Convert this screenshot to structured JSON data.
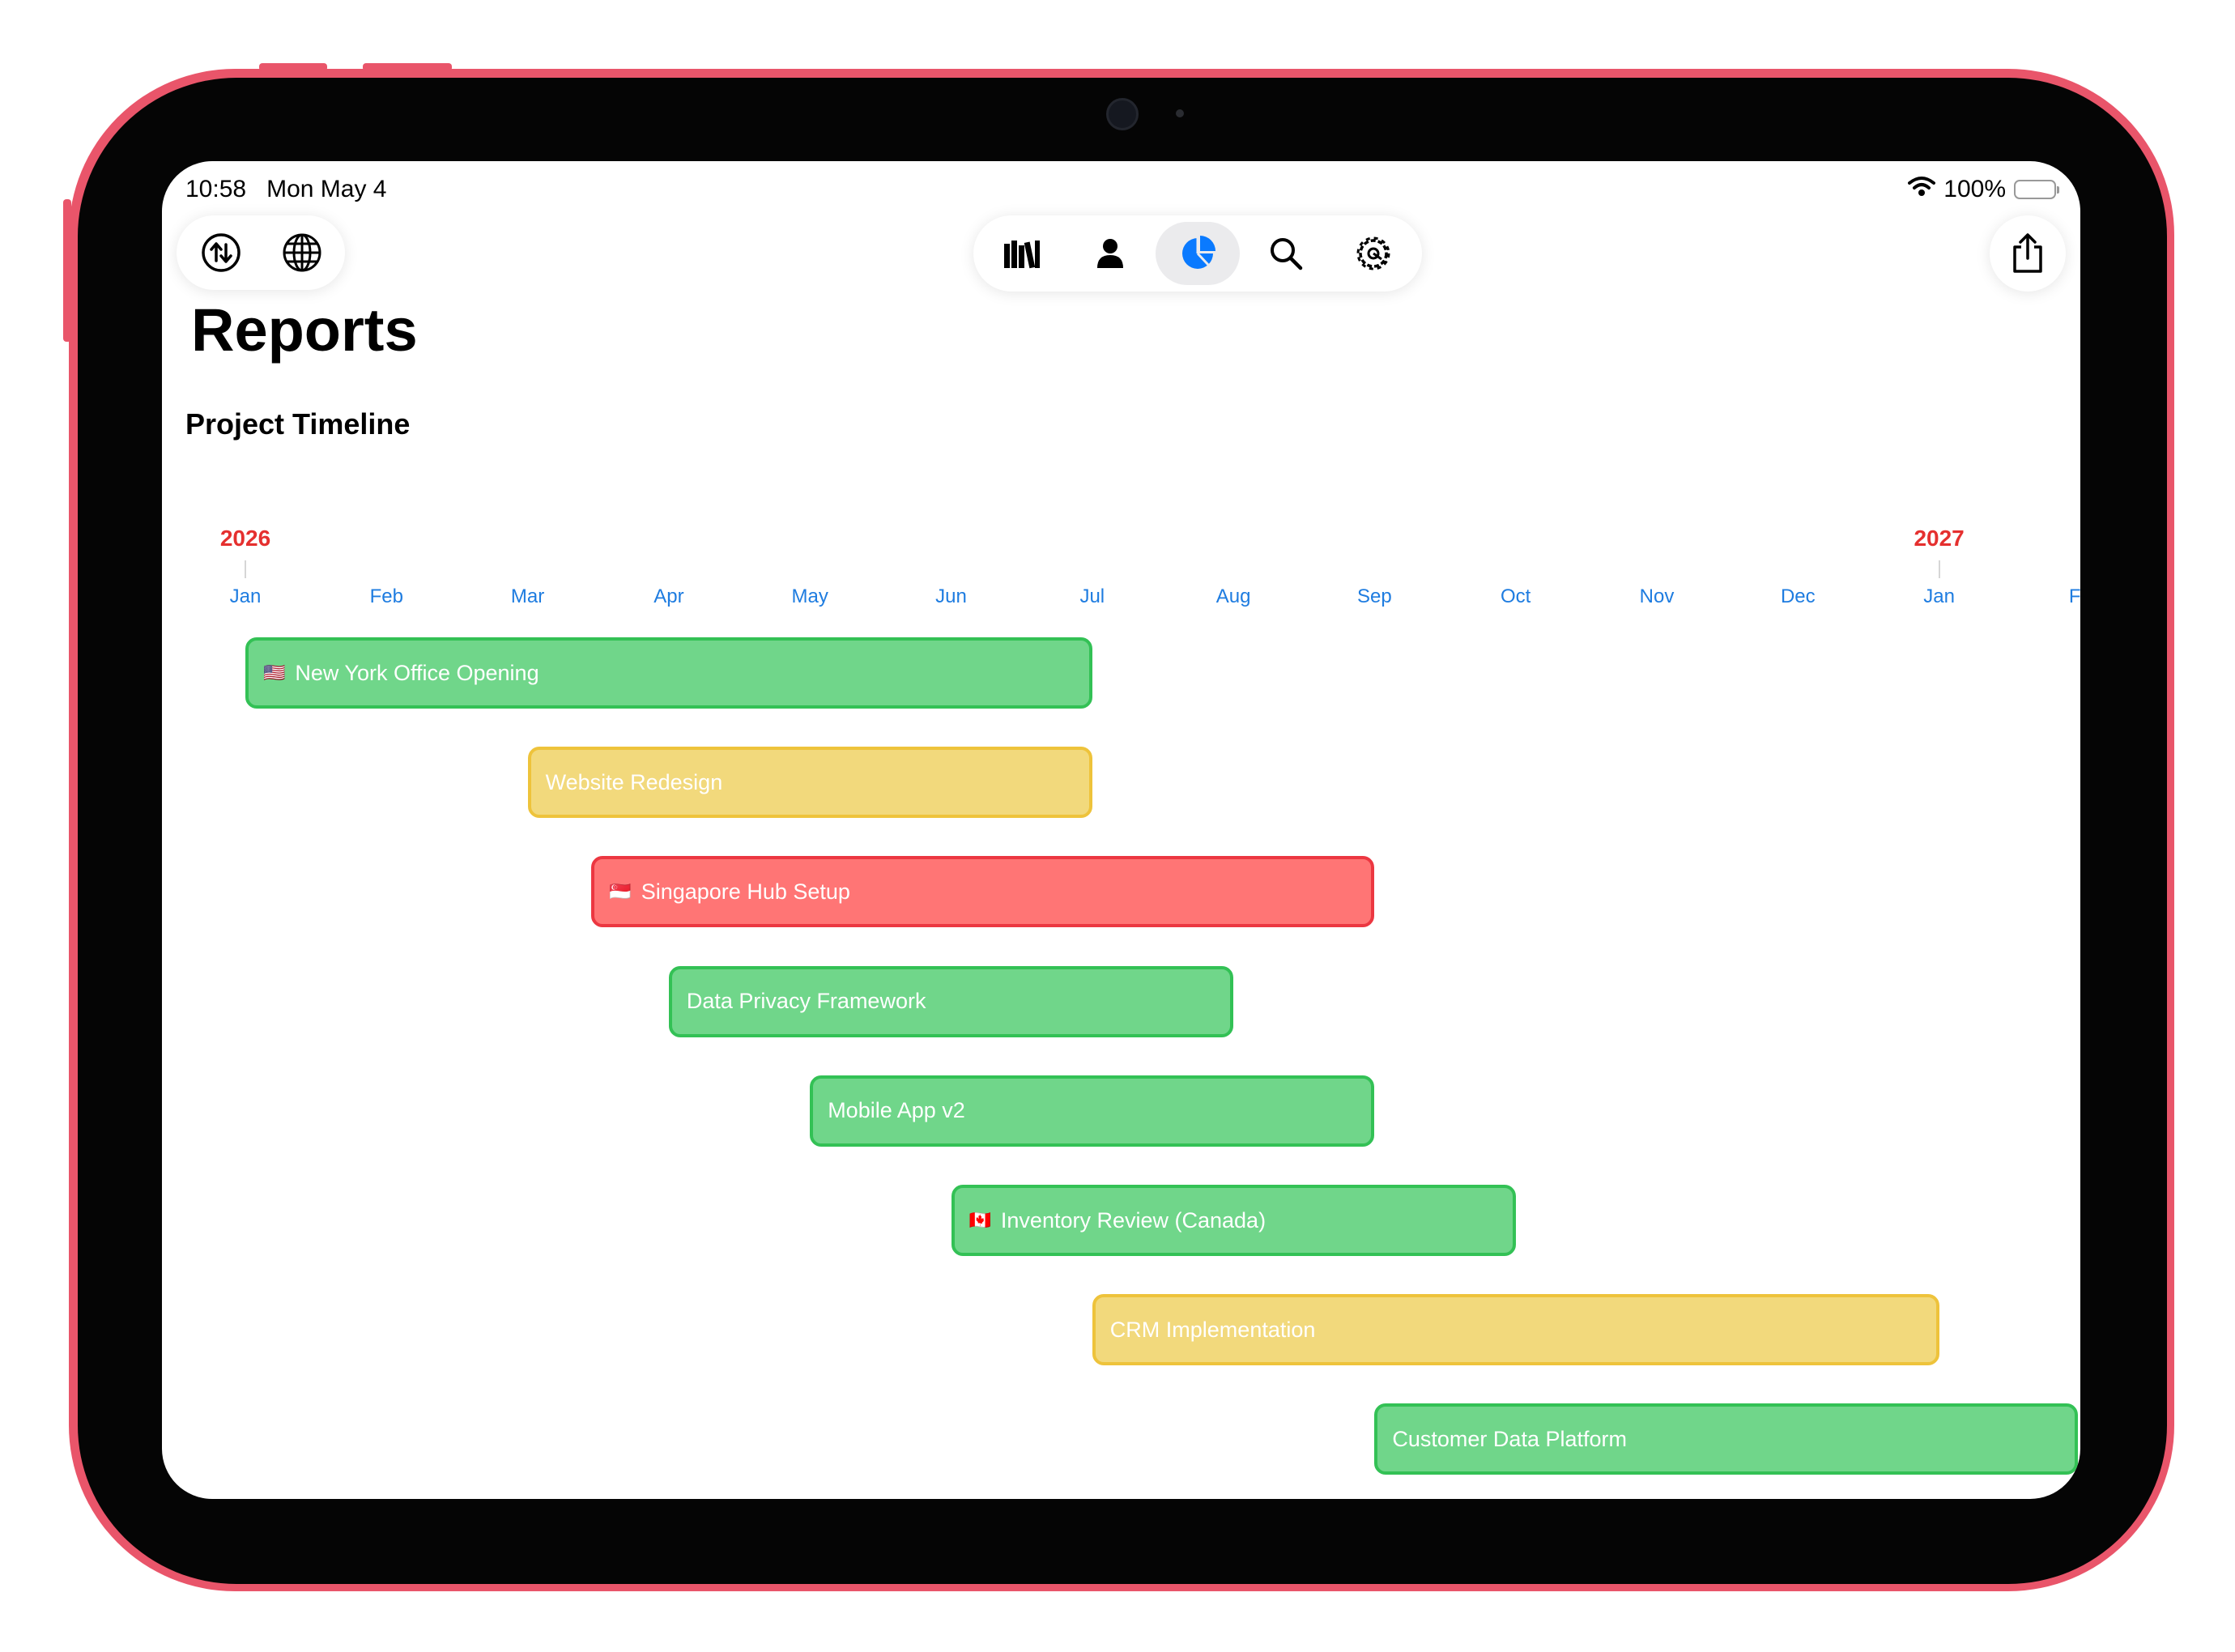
{
  "status_bar": {
    "time": "10:58",
    "date": "Mon May 4",
    "battery": "100%"
  },
  "toolbar": {
    "left_icons": [
      "sync-icon",
      "globe-icon"
    ],
    "tabs": [
      {
        "icon": "library-icon",
        "active": false
      },
      {
        "icon": "person-icon",
        "active": false
      },
      {
        "icon": "reports-pie-icon",
        "active": true
      },
      {
        "icon": "search-icon",
        "active": false
      },
      {
        "icon": "settings-gear-icon",
        "active": false
      }
    ],
    "right_icon": "share-icon",
    "accent_color": "#0a7aff"
  },
  "page": {
    "title": "Reports",
    "section_title": "Project Timeline"
  },
  "chart_data": {
    "type": "gantt",
    "years": [
      {
        "label": "2026",
        "month_index": 0
      },
      {
        "label": "2027",
        "month_index": 12
      }
    ],
    "months": [
      "Jan",
      "Feb",
      "Mar",
      "Apr",
      "May",
      "Jun",
      "Jul",
      "Aug",
      "Sep",
      "Oct",
      "Nov",
      "Dec",
      "Jan",
      "Fe"
    ],
    "colors": {
      "green": {
        "fill": "#70d68a",
        "border": "#33c155"
      },
      "yellow": {
        "fill": "#f2d97c",
        "border": "#eec33b"
      },
      "red": {
        "fill": "#ff7575",
        "border": "#ec3741"
      }
    },
    "tasks": [
      {
        "name": "New York Office Opening",
        "flag": "🇺🇸",
        "start": "2026-01-01",
        "end": "2026-07-01",
        "status": "green"
      },
      {
        "name": "Website Redesign",
        "flag": "",
        "start": "2026-03-01",
        "end": "2026-07-01",
        "status": "yellow"
      },
      {
        "name": "Singapore Hub Setup",
        "flag": "🇸🇬",
        "start": "2026-03-15",
        "end": "2026-09-01",
        "status": "red"
      },
      {
        "name": "Data Privacy Framework",
        "flag": "",
        "start": "2026-04-01",
        "end": "2026-08-01",
        "status": "green"
      },
      {
        "name": "Mobile App v2",
        "flag": "",
        "start": "2026-05-01",
        "end": "2026-09-01",
        "status": "green"
      },
      {
        "name": "Inventory Review (Canada)",
        "flag": "🇨🇦",
        "start": "2026-06-01",
        "end": "2026-10-01",
        "status": "green"
      },
      {
        "name": "CRM Implementation",
        "flag": "",
        "start": "2026-07-01",
        "end": "2027-01-01",
        "status": "yellow"
      },
      {
        "name": "Customer Data Platform",
        "flag": "",
        "start": "2026-09-01",
        "end": "2027-02-01",
        "status": "green"
      }
    ]
  }
}
